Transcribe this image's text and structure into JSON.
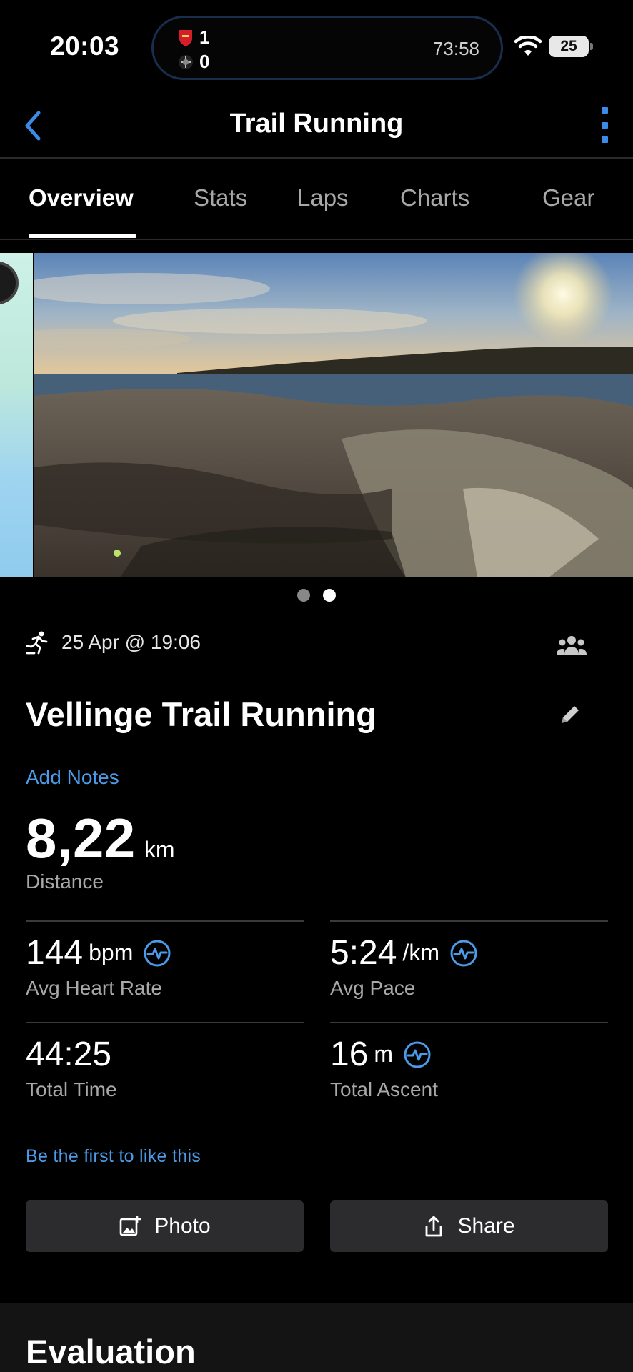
{
  "status_bar": {
    "time": "20:03",
    "score": {
      "home": "1",
      "away": "0"
    },
    "match_clock": "73:58",
    "battery": "25"
  },
  "nav": {
    "title": "Trail Running"
  },
  "tabs": [
    {
      "label": "Overview",
      "active": true
    },
    {
      "label": "Stats"
    },
    {
      "label": "Laps"
    },
    {
      "label": "Charts"
    },
    {
      "label": "Gear"
    }
  ],
  "activity": {
    "date": "25 Apr @ 19:06",
    "title": "Vellinge Trail Running",
    "add_notes": "Add Notes"
  },
  "distance": {
    "value": "8,22",
    "unit": "km",
    "label": "Distance"
  },
  "stats": [
    {
      "value": "144",
      "unit": "bpm",
      "label": "Avg Heart Rate",
      "icon": "heart-rate-icon"
    },
    {
      "value": "5:24",
      "unit": "/km",
      "label": "Avg Pace",
      "icon": "heart-rate-icon"
    },
    {
      "value": "44:25",
      "unit": "",
      "label": "Total Time"
    },
    {
      "value": "16",
      "unit": "m",
      "label": "Total Ascent",
      "icon": "heart-rate-icon"
    }
  ],
  "likes": "Be the first to like this",
  "buttons": {
    "photo": "Photo",
    "share": "Share"
  },
  "section": {
    "title": "Evaluation"
  },
  "colors": {
    "accent": "#4b9be8",
    "background": "#000000",
    "button": "#2c2c2e"
  }
}
